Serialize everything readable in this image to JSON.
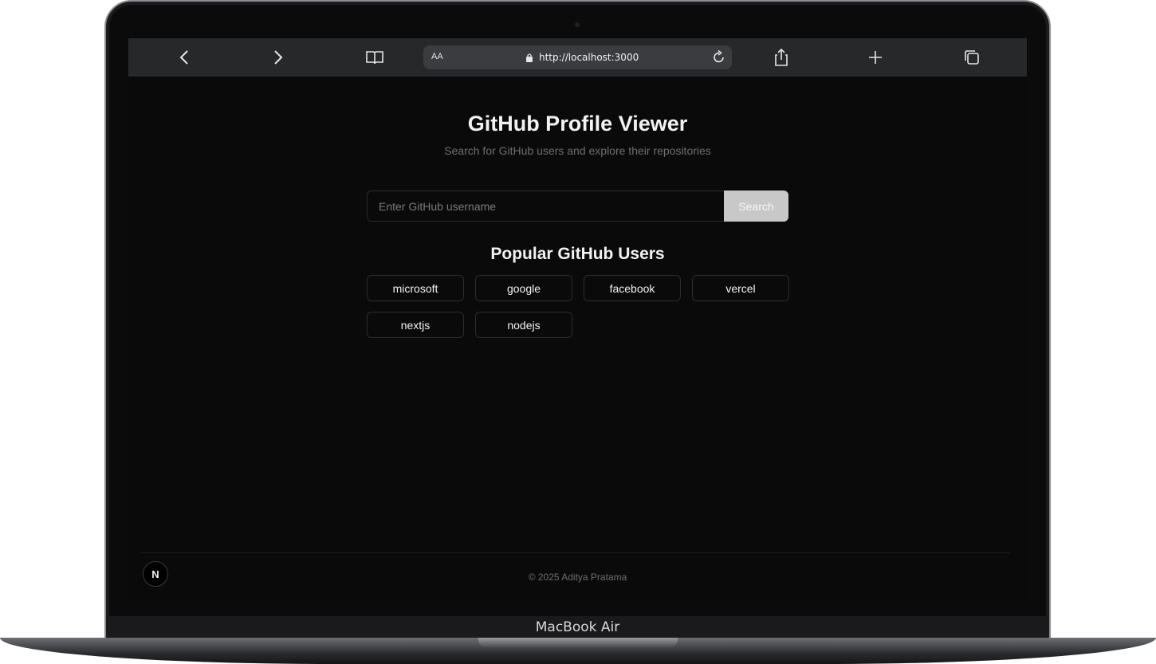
{
  "device": {
    "label": "MacBook Air"
  },
  "browser": {
    "text_size_label": "AA",
    "url": "http://localhost:3000",
    "icons": [
      "chevron-left-icon",
      "chevron-right-icon",
      "book-icon",
      "lock-icon",
      "reload-icon",
      "share-icon",
      "plus-icon",
      "tabs-icon"
    ]
  },
  "page": {
    "title": "GitHub Profile Viewer",
    "subtitle": "Search for GitHub users and explore their repositories",
    "search": {
      "placeholder": "Enter GitHub username",
      "value": "",
      "button_label": "Search"
    },
    "popular": {
      "title": "Popular GitHub Users",
      "users": [
        "microsoft",
        "google",
        "facebook",
        "vercel",
        "nextjs",
        "nodejs"
      ]
    },
    "footer": "© 2025 Aditya Pratama",
    "dev_badge": "N"
  },
  "colors": {
    "background": "#0a0a0a",
    "toolbar": "#27282a",
    "search_button": "#c8c8c8"
  }
}
